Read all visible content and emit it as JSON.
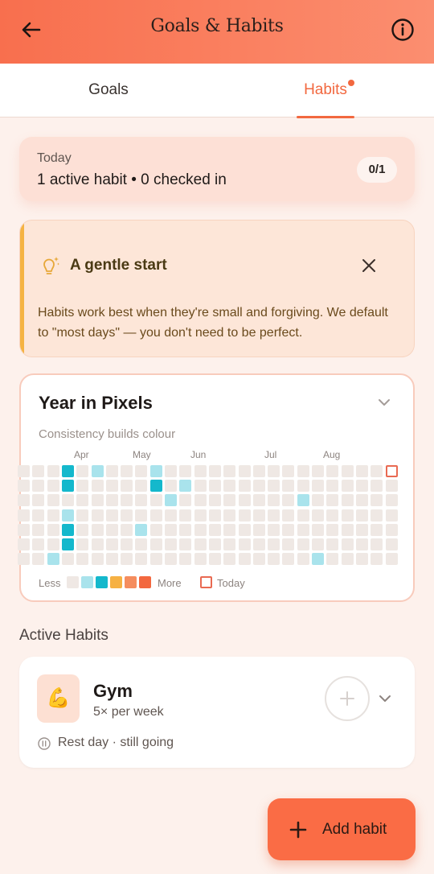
{
  "header": {
    "title": "Goals & Habits",
    "back_icon": "arrow-left-icon",
    "info_icon": "info-circle-icon",
    "gradient_colors": [
      "#f86f4e",
      "#fb8e70"
    ]
  },
  "tabs": [
    {
      "label": "Goals",
      "active": false
    },
    {
      "label": "Habits",
      "active": true,
      "has_notification_dot": true
    }
  ],
  "today": {
    "label": "Today",
    "summary": "1 active habit • 0 checked in",
    "count": "0/1"
  },
  "tip": {
    "icon": "lightbulb-icon",
    "title": "A gentle start",
    "body": "Habits work best when they're small and forgiving. We default to \"most days\" — you don't need to be perfect.",
    "close_icon": "close-icon"
  },
  "year_in_pixels": {
    "title": "Year in Pixels",
    "subtitle": "Consistency builds colour",
    "months": [
      "Apr",
      "May",
      "Jun",
      "Jul",
      "Aug"
    ],
    "legend": {
      "less": "Less",
      "more": "More",
      "today": "Today",
      "colors": [
        "#efe8e4",
        "#a9e3ec",
        "#14b8cc",
        "#f6b143",
        "#f58d5e",
        "#f3683f"
      ]
    },
    "colors": {
      "empty": "#efe8e4",
      "light": "#a9e3ec",
      "strong": "#14b8cc",
      "today_border": "#e96a52"
    },
    "weeks": 26,
    "filled_cells": [
      {
        "week": 3,
        "day": 0,
        "level": 2
      },
      {
        "week": 3,
        "day": 1,
        "level": 2
      },
      {
        "week": 3,
        "day": 3,
        "level": 1
      },
      {
        "week": 3,
        "day": 4,
        "level": 2
      },
      {
        "week": 3,
        "day": 5,
        "level": 2
      },
      {
        "week": 2,
        "day": 6,
        "level": 1
      },
      {
        "week": 5,
        "day": 0,
        "level": 1
      },
      {
        "week": 8,
        "day": 4,
        "level": 1
      },
      {
        "week": 9,
        "day": 0,
        "level": 1
      },
      {
        "week": 9,
        "day": 1,
        "level": 2
      },
      {
        "week": 10,
        "day": 2,
        "level": 1
      },
      {
        "week": 11,
        "day": 1,
        "level": 1
      },
      {
        "week": 19,
        "day": 2,
        "level": 1
      },
      {
        "week": 20,
        "day": 6,
        "level": 1
      }
    ],
    "today_cell": {
      "week": 25,
      "day": 0
    }
  },
  "active_habits": {
    "section_title": "Active Habits",
    "items": [
      {
        "emoji": "💪",
        "name": "Gym",
        "frequency": "5× per week",
        "status": "Rest day · still going",
        "status_icon": "pause-circle-icon"
      }
    ]
  },
  "fab": {
    "label": "Add habit",
    "icon": "plus-icon",
    "color": "#fa6c45"
  }
}
